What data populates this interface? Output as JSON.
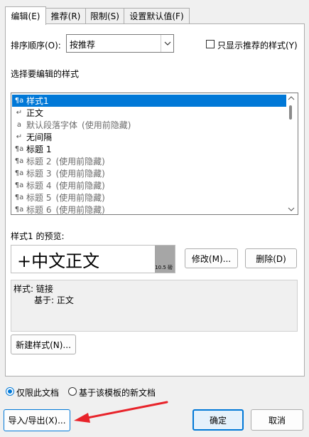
{
  "tabs": [
    "编辑(E)",
    "推荐(R)",
    "限制(S)",
    "设置默认值(F)"
  ],
  "sort_order": {
    "label": "排序顺序(O):",
    "value": "按推荐"
  },
  "only_recommended": {
    "label": "只显示推荐的样式(Y)",
    "checked": false
  },
  "select_label": "选择要编辑的样式",
  "styles": [
    {
      "icon": "¶a",
      "name": "样式1",
      "hidden": "",
      "selected": true
    },
    {
      "icon": "↵",
      "name": "正文",
      "hidden": ""
    },
    {
      "icon": "a",
      "name": "默认段落字体",
      "hidden": "(使用前隐藏)"
    },
    {
      "icon": "↵",
      "name": "无间隔",
      "hidden": ""
    },
    {
      "icon": "¶a",
      "name": "标题 1",
      "hidden": ""
    },
    {
      "icon": "¶a",
      "name": "标题 2",
      "hidden": "(使用前隐藏)"
    },
    {
      "icon": "¶a",
      "name": "标题 3",
      "hidden": "(使用前隐藏)"
    },
    {
      "icon": "¶a",
      "name": "标题 4",
      "hidden": "(使用前隐藏)"
    },
    {
      "icon": "¶a",
      "name": "标题 5",
      "hidden": "(使用前隐藏)"
    },
    {
      "icon": "¶a",
      "name": "标题 6",
      "hidden": "(使用前隐藏)"
    }
  ],
  "preview": {
    "label": "样式1 的预览:",
    "sample": "+中文正文",
    "size": "10.5 磅"
  },
  "buttons": {
    "modify": "修改(M)...",
    "delete": "删除(D)",
    "new_style": "新建样式(N)...",
    "import_export": "导入/导出(X)...",
    "ok": "确定",
    "cancel": "取消"
  },
  "description": {
    "line1": "样式: 链接",
    "line2": "基于: 正文"
  },
  "scope": [
    {
      "label": "仅限此文档",
      "selected": true
    },
    {
      "label": "基于该模板的新文档",
      "selected": false
    }
  ],
  "colors": {
    "selection": "#0078d7",
    "arrow": "#e8232a"
  }
}
